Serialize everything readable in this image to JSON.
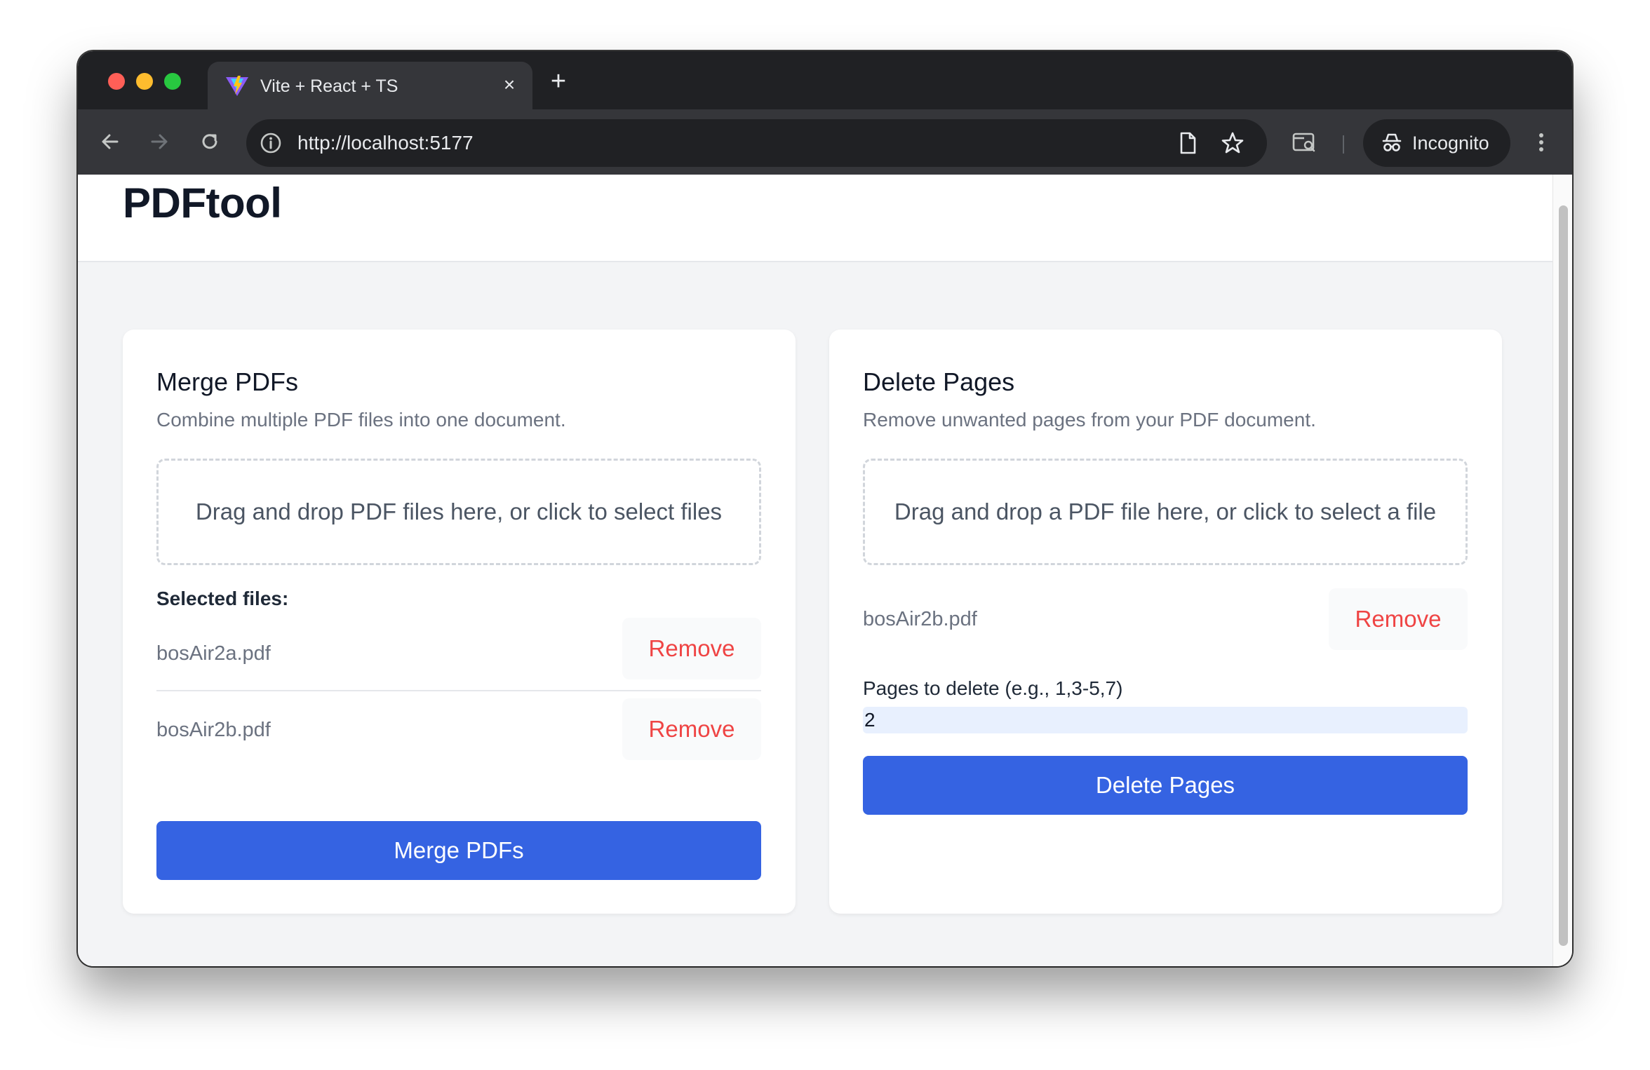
{
  "browser": {
    "tab": {
      "title": "Vite + React + TS",
      "close_glyph": "×"
    },
    "new_tab_glyph": "+",
    "address": {
      "url": "http://localhost:5177"
    },
    "incognito_label": "Incognito",
    "icons": [
      "back-icon",
      "forward-icon",
      "reload-icon",
      "info-icon",
      "page-icon",
      "star-icon",
      "tab-search-icon",
      "incognito-icon",
      "more-menu-icon"
    ]
  },
  "app": {
    "brand": "PDFtool"
  },
  "merge": {
    "title": "Merge PDFs",
    "subtitle": "Combine multiple PDF files into one document.",
    "dropzone_text": "Drag and drop PDF files here, or click to select files",
    "selected_label": "Selected files:",
    "files": [
      {
        "name": "bosAir2a.pdf",
        "remove_label": "Remove"
      },
      {
        "name": "bosAir2b.pdf",
        "remove_label": "Remove"
      }
    ],
    "action_label": "Merge PDFs"
  },
  "delete_pages": {
    "title": "Delete Pages",
    "subtitle": "Remove unwanted pages from your PDF document.",
    "dropzone_text": "Drag and drop a PDF file here, or click to select a file",
    "file": {
      "name": "bosAir2b.pdf",
      "remove_label": "Remove"
    },
    "pages_label": "Pages to delete (e.g., 1,3-5,7)",
    "pages_value": "2",
    "action_label": "Delete Pages"
  },
  "colors": {
    "primary": "#3563e2",
    "danger": "#ef4444",
    "page_bg": "#f3f4f6"
  }
}
